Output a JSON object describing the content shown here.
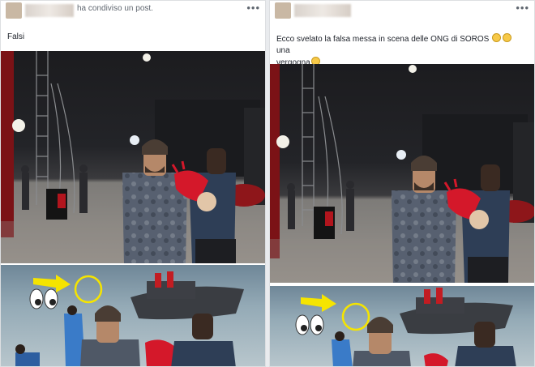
{
  "posts": [
    {
      "header": {
        "shared_text": "ha condiviso un post."
      },
      "caption": "Falsi"
    },
    {
      "header": {
        "shared_text": ""
      },
      "caption": "Ecco svelato la falsa messa in scena delle ONG di SOROS",
      "caption_tail_1": "una",
      "caption_line2": "vergogna"
    }
  ],
  "icons": {
    "more": "more-options-icon",
    "emoji": "crying-face-emoji",
    "arrow": "arrow-annotation",
    "eyes": "eyes-emoji"
  },
  "colors": {
    "annotation_yellow": "#f5e400",
    "doll_red": "#d4182a"
  }
}
